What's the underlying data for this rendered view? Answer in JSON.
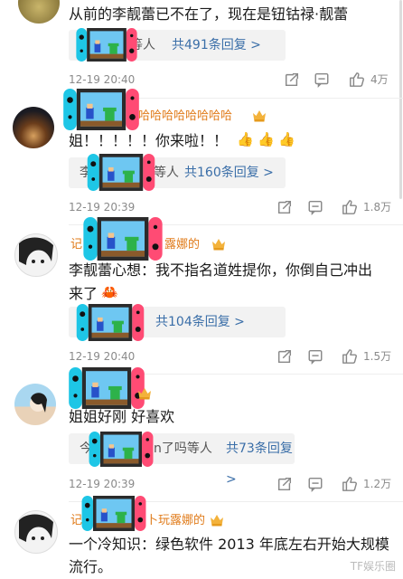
{
  "comments": [
    {
      "text": "从前的李靓蕾已不在了，现在是钮钴禄·靓蕾",
      "reply_left": "等人",
      "reply_link": "共491条回复 >",
      "time": "12-19 20:40",
      "likes": "4万"
    },
    {
      "name": "哈哈哈哈哈哈哈哈",
      "text": "姐！！！！！你来啦！！",
      "reply_left_a": "李",
      "reply_left_b": "等人",
      "reply_link": "共160条回复 >",
      "time": "12-19 20:39",
      "likes": "1.8万"
    },
    {
      "name_a": "记",
      "name_b": "露娜的",
      "text_line1": "李靓蕾心想：我不指名道姓提你，你倒自己冲出",
      "text_line2": "来了",
      "reply_link": "共104条回复 >",
      "time": "12-19 20:40",
      "likes": "1.5万"
    },
    {
      "text": "姐姐好刚 好喜欢",
      "reply_left_a": "今",
      "reply_left_b": "n了吗等人",
      "reply_link": "共73条回复 >",
      "time": "12-19 20:39",
      "likes": "1.2万"
    },
    {
      "name_a": "记",
      "name_b": "卜玩露娜的",
      "text_line1": "一个冷知识：绿色软件 2013 年底左右开始大规模",
      "text_line2": "流行。"
    }
  ],
  "watermark": "TF娱乐圈",
  "icons": [
    "share-icon",
    "comment-icon",
    "like-icon",
    "crown-icon",
    "thumbs-up-emoji",
    "crab-emoji",
    "switch-sticker"
  ],
  "colors": {
    "name": "#e07b1a",
    "link": "#3a6ea8",
    "gray": "#8a8a8a",
    "reply_bg": "#f2f2f2"
  }
}
